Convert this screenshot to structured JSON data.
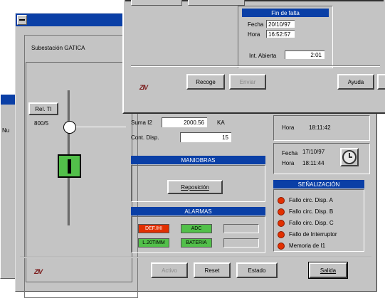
{
  "app": {
    "window_icon": "minus-icon"
  },
  "back_window": {
    "side_label": "Nu",
    "logo_text": "ZIV"
  },
  "top_dialog": {
    "fault_header": "Fin de falta",
    "fecha_label": "Fecha",
    "fecha_value": "20/10/97",
    "hora_label": "Hora",
    "hora_value": "16:52:57",
    "int_abierta_label": "Int. Abierta",
    "int_abierta_value": "2:01",
    "buttons": {
      "recoge": "Recoge",
      "enviar": "Enviar",
      "ayuda": "Ayuda"
    },
    "logo_text": "ZIV"
  },
  "main_window": {
    "subestacion_label": "Subestación",
    "subestacion_value": "GATICA",
    "rel_ti_button": "Rel. TI",
    "ratio_text": "800/5",
    "sumat_label": "Suma I2",
    "sumat_value": "2000.56",
    "sumat_unit": "KA",
    "cont_disp_label": "Cont. Disp.",
    "cont_disp_value": "15",
    "hora_top_label": "Hora",
    "hora_top_value": "18:11:42",
    "fecha2_label": "Fecha",
    "fecha2_value": "17/10/97",
    "hora2_label": "Hora",
    "hora2_value": "18:11:44",
    "maniobras_header": "MANIOBRAS",
    "reposicion_button": "Reposición",
    "alarmas_header": "ALARMAS",
    "alarms": [
      {
        "label": "DEF.IHI",
        "color": "#e23000"
      },
      {
        "label": "ADC",
        "color": "#52c04a"
      },
      {
        "label": "L.20TIMM",
        "color": "#52c04a"
      },
      {
        "label": "BATERIA",
        "color": "#52c04a"
      }
    ],
    "senalizacion_header": "SEÑALIZACIÓN",
    "signals": [
      "Fallo circ. Disp. A",
      "Fallo circ. Disp. B",
      "Fallo circ. Disp. C",
      "Fallo de Interruptor",
      "Memoria de I1"
    ],
    "buttons": {
      "activo": "Activo",
      "reset": "Reset",
      "estado": "Estado",
      "salida": "Salida"
    },
    "logo_text": "ZIV",
    "colors": {
      "blue_header": "#0a3fa6",
      "panel_gray": "#c4c4c4",
      "breaker_green": "#52c04a"
    }
  }
}
